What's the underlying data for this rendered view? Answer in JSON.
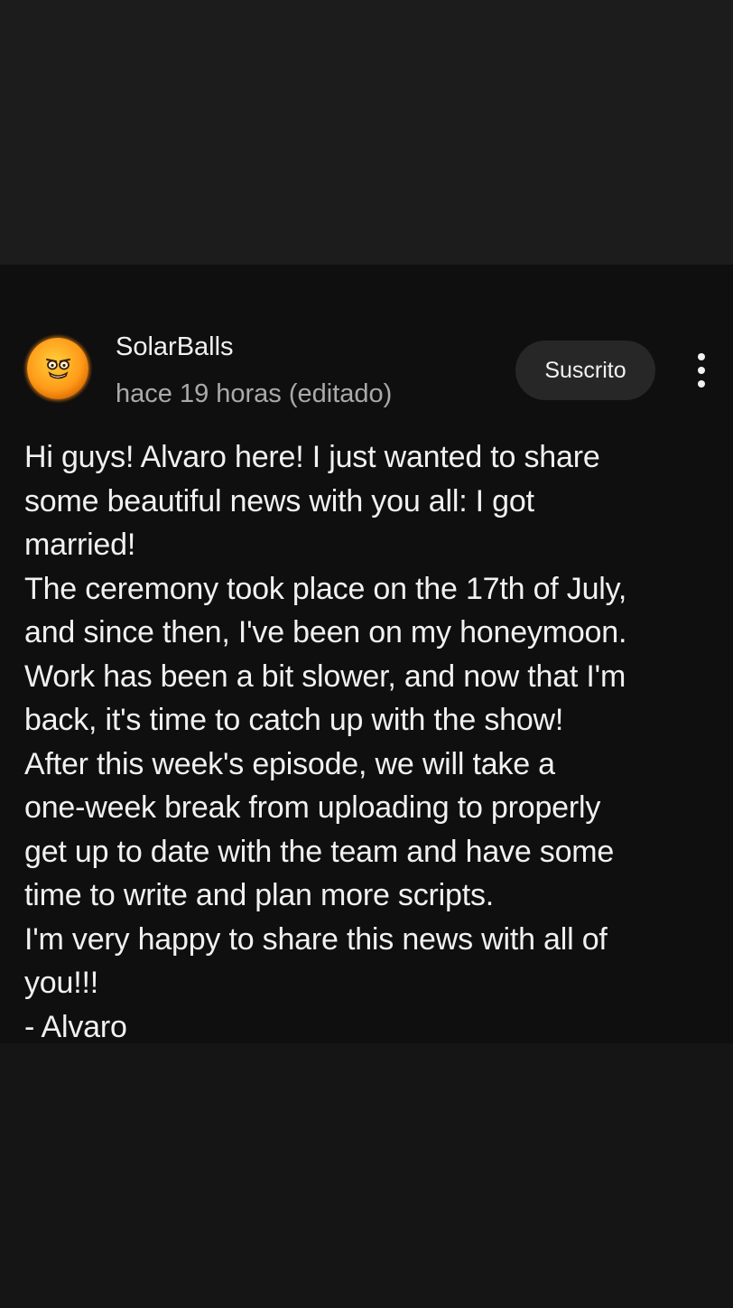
{
  "post": {
    "channel_name": "SolarBalls",
    "timestamp": "hace 19 horas (editado)",
    "subscribe_label": "Suscrito",
    "more_icon": "more-vert-icon",
    "body_lines": [
      "Hi guys! Alvaro here! I just wanted to share",
      "some beautiful news with you all: I got",
      "married!",
      "The ceremony took place on the 17th of July,",
      "and since then, I've been on my honeymoon.",
      "Work has been a bit slower, and now that I'm",
      "back, it's time to catch up with the show!",
      "After this week's episode, we will take a",
      "one-week break from uploading to properly",
      "get up to date with the team and have some",
      "time to write and plan more scripts.",
      "I'm very happy to share this news with all of",
      "you!!!",
      "- Alvaro"
    ]
  },
  "colors": {
    "background": "#0f0f0f",
    "text_primary": "#f1f1f1",
    "text_secondary": "#aaaaaa",
    "button_bg": "#272727",
    "avatar_orange": "#ff9a18"
  }
}
